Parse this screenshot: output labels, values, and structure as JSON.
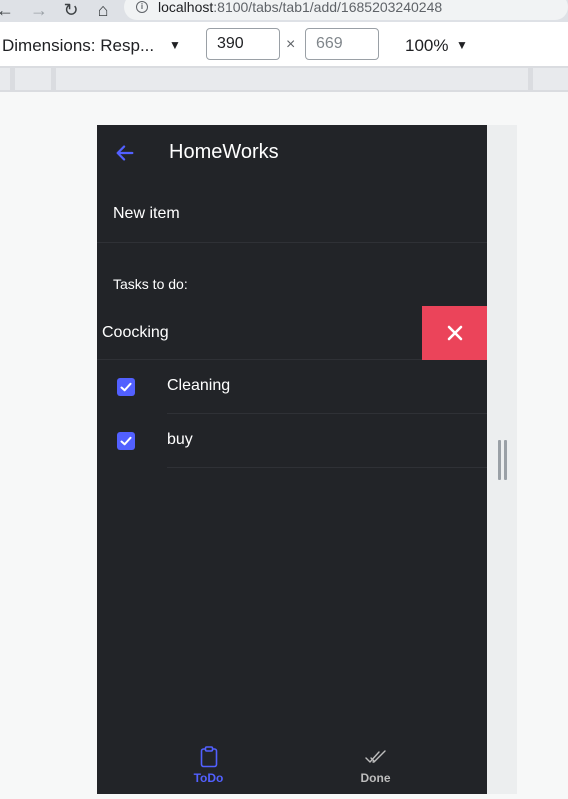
{
  "browser": {
    "url_host": "localhost",
    "url_path": ":8100/tabs/tab1/add/1685203240248",
    "back_glyph": "←",
    "forward_glyph": "→",
    "reload_glyph": "↻",
    "home_glyph": "⌂",
    "info_glyph": "i"
  },
  "device_toolbar": {
    "dimensions_label": "Dimensions: Resp...",
    "caret": "▼",
    "width_value": "390",
    "height_value": "669",
    "times": "×",
    "zoom_value": "100%"
  },
  "app": {
    "title": "HomeWorks",
    "new_item_placeholder": "New item",
    "list_header": "Tasks to do:",
    "swiped_item": "Coocking",
    "items": [
      {
        "label": "Cleaning",
        "checked": true
      },
      {
        "label": "buy",
        "checked": true
      }
    ],
    "tabs": [
      {
        "label": "ToDo",
        "icon": "clipboard-icon",
        "selected": true
      },
      {
        "label": "Done",
        "icon": "done-all-icon",
        "selected": false
      }
    ]
  },
  "colors": {
    "primary": "#5260ff",
    "danger": "#eb445a",
    "app_background": "#222428"
  }
}
